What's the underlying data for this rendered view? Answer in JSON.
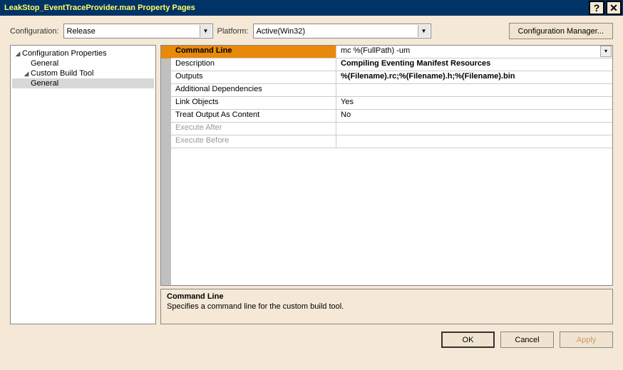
{
  "titlebar": {
    "title": "LeakStop_EventTraceProvider.man Property Pages"
  },
  "toolbar": {
    "configLabel": "Configuration:",
    "configValue": "Release",
    "platformLabel": "Platform:",
    "platformValue": "Active(Win32)",
    "configMgrLabel": "Configuration Manager..."
  },
  "tree": {
    "root": "Configuration Properties",
    "node1": "General",
    "node2": "Custom Build Tool",
    "node2child": "General"
  },
  "grid": {
    "rows": [
      {
        "name": "Command Line",
        "value": "mc %(FullPath) -um",
        "selected": true,
        "bold": false,
        "hasDropdown": true
      },
      {
        "name": "Description",
        "value": "Compiling Eventing Manifest Resources",
        "bold": true
      },
      {
        "name": "Outputs",
        "value": "%(Filename).rc;%(Filename).h;%(Filename).bin",
        "bold": true
      },
      {
        "name": "Additional Dependencies",
        "value": ""
      },
      {
        "name": "Link Objects",
        "value": "Yes"
      },
      {
        "name": "Treat Output As Content",
        "value": "No"
      },
      {
        "name": "Execute After",
        "value": "",
        "disabled": true
      },
      {
        "name": "Execute Before",
        "value": "",
        "disabled": true
      }
    ]
  },
  "desc": {
    "title": "Command Line",
    "text": "Specifies a command line for the custom build tool."
  },
  "footer": {
    "ok": "OK",
    "cancel": "Cancel",
    "apply": "Apply"
  }
}
